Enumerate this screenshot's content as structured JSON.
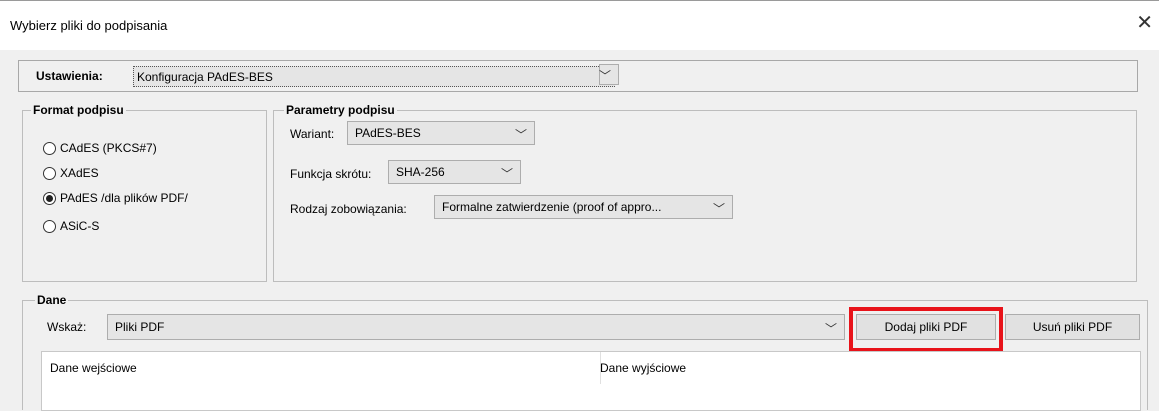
{
  "window": {
    "title": "Wybierz pliki do podpisania",
    "close": "✕"
  },
  "settings": {
    "label": "Ustawienia:",
    "value": "Konfiguracja PAdES-BES"
  },
  "format": {
    "title": "Format podpisu",
    "options": [
      {
        "label": "CAdES (PKCS#7)",
        "checked": false
      },
      {
        "label": "XAdES",
        "checked": false
      },
      {
        "label": "PAdES /dla plików PDF/",
        "checked": true
      },
      {
        "label": "ASiC-S",
        "checked": false
      }
    ]
  },
  "params": {
    "title": "Parametry podpisu",
    "variant_label": "Wariant:",
    "variant_value": "PAdES-BES",
    "hash_label": "Funkcja skrótu:",
    "hash_value": "SHA-256",
    "commitment_label": "Rodzaj zobowiązania:",
    "commitment_value": "Formalne zatwierdzenie (proof of appro..."
  },
  "data": {
    "title": "Dane",
    "show_label": "Wskaż:",
    "show_value": "Pliki PDF",
    "add_button": "Dodaj pliki PDF",
    "remove_button": "Usuń pliki PDF",
    "columns": [
      "Dane wejściowe",
      "Dane wyjściowe"
    ]
  },
  "icons": {
    "chevron": "chevron-down-icon",
    "close": "close-icon"
  },
  "colors": {
    "highlight": "#e8131a"
  }
}
